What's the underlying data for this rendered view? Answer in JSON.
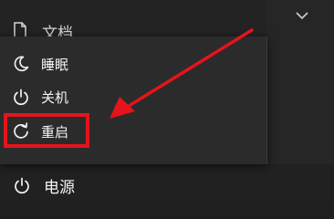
{
  "start_menu": {
    "docs_label": "文档",
    "power_label": "电源"
  },
  "power_menu": {
    "items": [
      {
        "label": "睡眠",
        "icon": "moon-icon"
      },
      {
        "label": "关机",
        "icon": "power-icon"
      },
      {
        "label": "重启",
        "icon": "restart-icon"
      }
    ]
  },
  "annotation": {
    "color": "#e4141b"
  }
}
